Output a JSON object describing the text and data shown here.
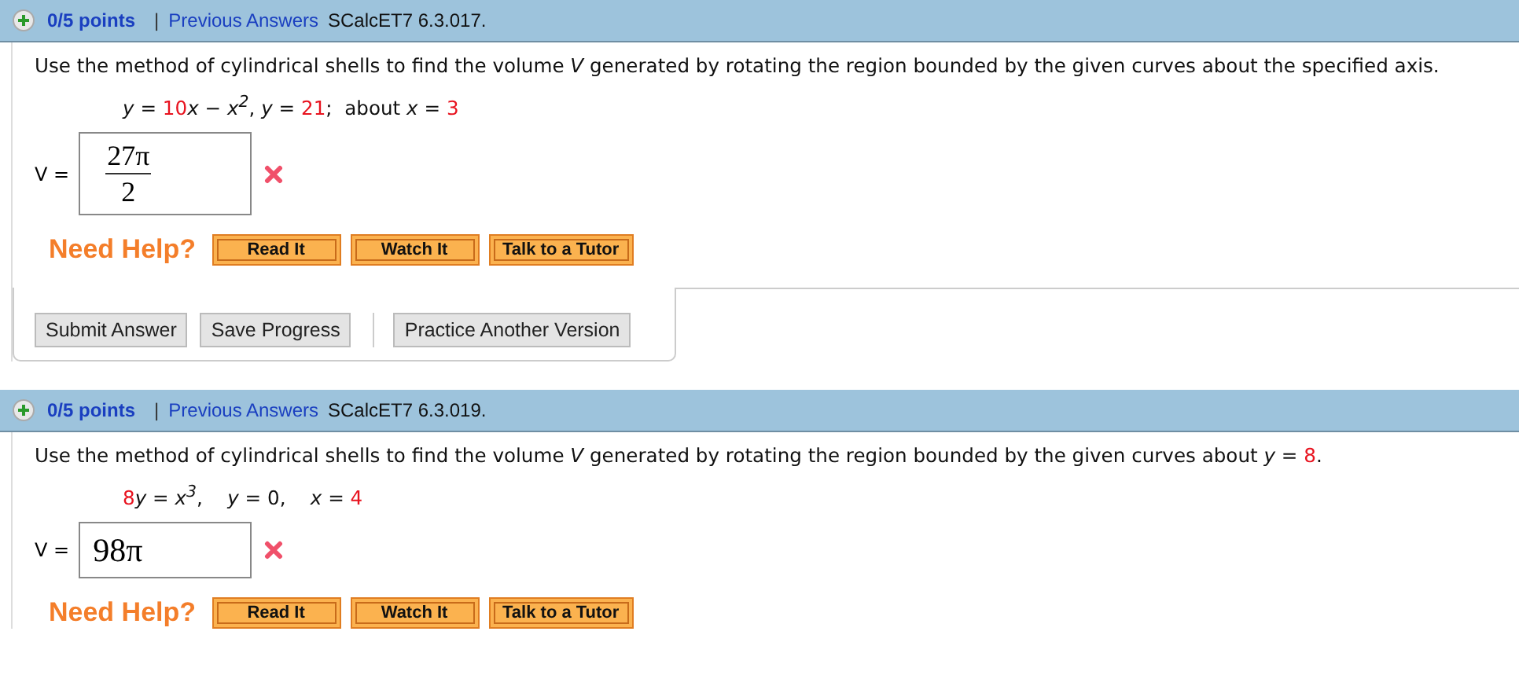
{
  "problems": [
    {
      "points": "0/5 points",
      "separator": "|",
      "previous_answers": "Previous Answers",
      "code": "SCalcET7 6.3.017.",
      "prompt": [
        {
          "kind": "text",
          "text": "Use the method of cylindrical shells to find the volume "
        },
        {
          "kind": "var",
          "text": "V"
        },
        {
          "kind": "text",
          "text": " generated by rotating the region bounded by the given curves about the specified axis."
        }
      ],
      "equation": [
        {
          "kind": "var",
          "text": "y"
        },
        {
          "kind": "text",
          "text": " = "
        },
        {
          "kind": "num",
          "text": "10"
        },
        {
          "kind": "var",
          "text": "x"
        },
        {
          "kind": "text",
          "text": " − "
        },
        {
          "kind": "var",
          "text": "x$^{2}$"
        },
        {
          "kind": "text",
          "text": ", "
        },
        {
          "kind": "var",
          "text": "y"
        },
        {
          "kind": "text",
          "text": " = "
        },
        {
          "kind": "num",
          "text": "21"
        },
        {
          "kind": "text",
          "text": ";  about "
        },
        {
          "kind": "var",
          "text": "x"
        },
        {
          "kind": "text",
          "text": " = "
        },
        {
          "kind": "num",
          "text": "3"
        }
      ],
      "answer_label": "V =",
      "answer": {
        "kind": "fraction",
        "numerator": "27π",
        "denominator": "2"
      },
      "correct": false,
      "help_label": "Need Help?",
      "help_buttons": [
        "Read It",
        "Watch It",
        "Talk to a Tutor"
      ],
      "actions": [
        "Submit Answer",
        "Save Progress"
      ],
      "extra_action": "Practice Another Version"
    },
    {
      "points": "0/5 points",
      "separator": "|",
      "previous_answers": "Previous Answers",
      "code": "SCalcET7 6.3.019.",
      "prompt": [
        {
          "kind": "text",
          "text": "Use the method of cylindrical shells to find the volume "
        },
        {
          "kind": "var",
          "text": "V"
        },
        {
          "kind": "text",
          "text": " generated by rotating the region bounded by the given curves about "
        },
        {
          "kind": "var",
          "text": "y"
        },
        {
          "kind": "text",
          "text": " = "
        },
        {
          "kind": "num",
          "text": "8"
        },
        {
          "kind": "text",
          "text": "."
        }
      ],
      "equation": [
        {
          "kind": "num",
          "text": "8"
        },
        {
          "kind": "var",
          "text": "y"
        },
        {
          "kind": "text",
          "text": " = "
        },
        {
          "kind": "var",
          "text": "x$^{3}$"
        },
        {
          "kind": "text",
          "text": ",    "
        },
        {
          "kind": "var",
          "text": "y"
        },
        {
          "kind": "text",
          "text": " = 0,    "
        },
        {
          "kind": "var",
          "text": "x"
        },
        {
          "kind": "text",
          "text": " = "
        },
        {
          "kind": "num",
          "text": "4"
        }
      ],
      "answer_label": "V =",
      "answer": {
        "kind": "plain",
        "value": "98π"
      },
      "correct": false,
      "help_label": "Need Help?",
      "help_buttons": [
        "Read It",
        "Watch It",
        "Talk to a Tutor"
      ]
    }
  ]
}
